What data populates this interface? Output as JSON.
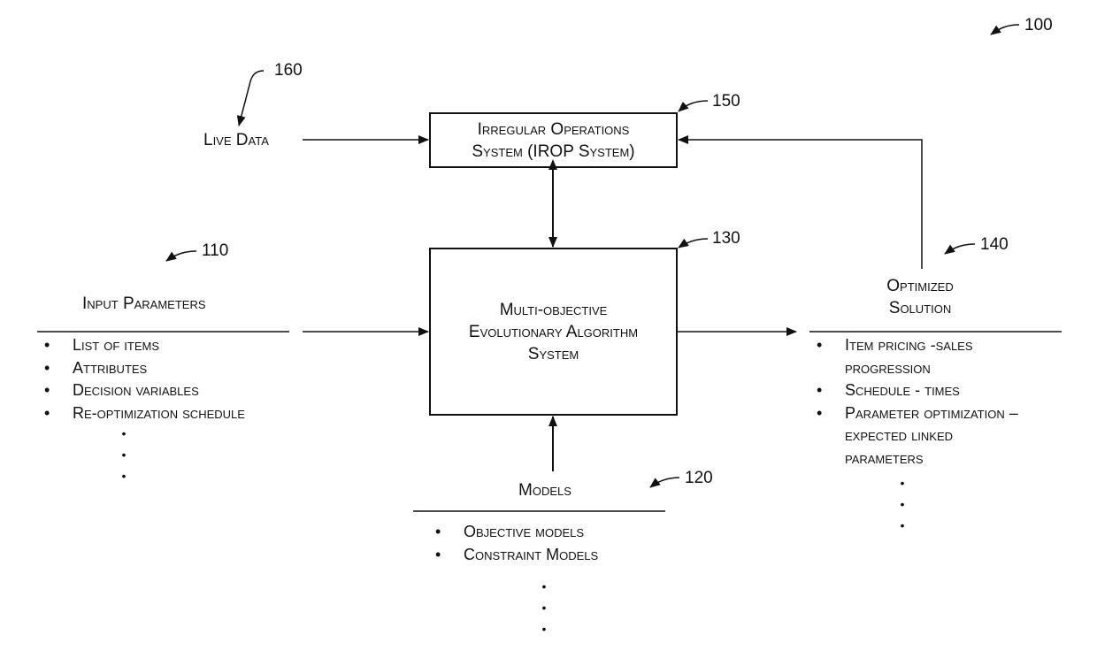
{
  "refs": {
    "figure": "100",
    "input_parameters": "110",
    "models": "120",
    "moea_system": "130",
    "optimized_solution": "140",
    "irop_system": "150",
    "live_data": "160"
  },
  "live_data": {
    "label": "Live Data"
  },
  "irop_box": {
    "line1": "Irregular Operations",
    "line2": "System (IROP System)"
  },
  "moea_box": {
    "line1": "Multi-objective",
    "line2": "Evolutionary Algorithm",
    "line3": "System"
  },
  "input_parameters": {
    "title": "Input Parameters",
    "items": [
      "List of items",
      "Attributes",
      "Decision variables",
      "Re-optimization schedule"
    ],
    "continuation": "⋮"
  },
  "models": {
    "title": "Models",
    "items": [
      "Objective models",
      "Constraint Models"
    ],
    "continuation": "⋮"
  },
  "optimized_solution": {
    "title_line1": "Optimized",
    "title_line2": "Solution",
    "items": [
      {
        "line1": "Item pricing -sales",
        "line2": "progression"
      },
      {
        "line1": "Schedule - times"
      },
      {
        "line1": "Parameter optimization –",
        "line2": "expected linked",
        "line3": "parameters"
      }
    ],
    "continuation": "⋮"
  }
}
